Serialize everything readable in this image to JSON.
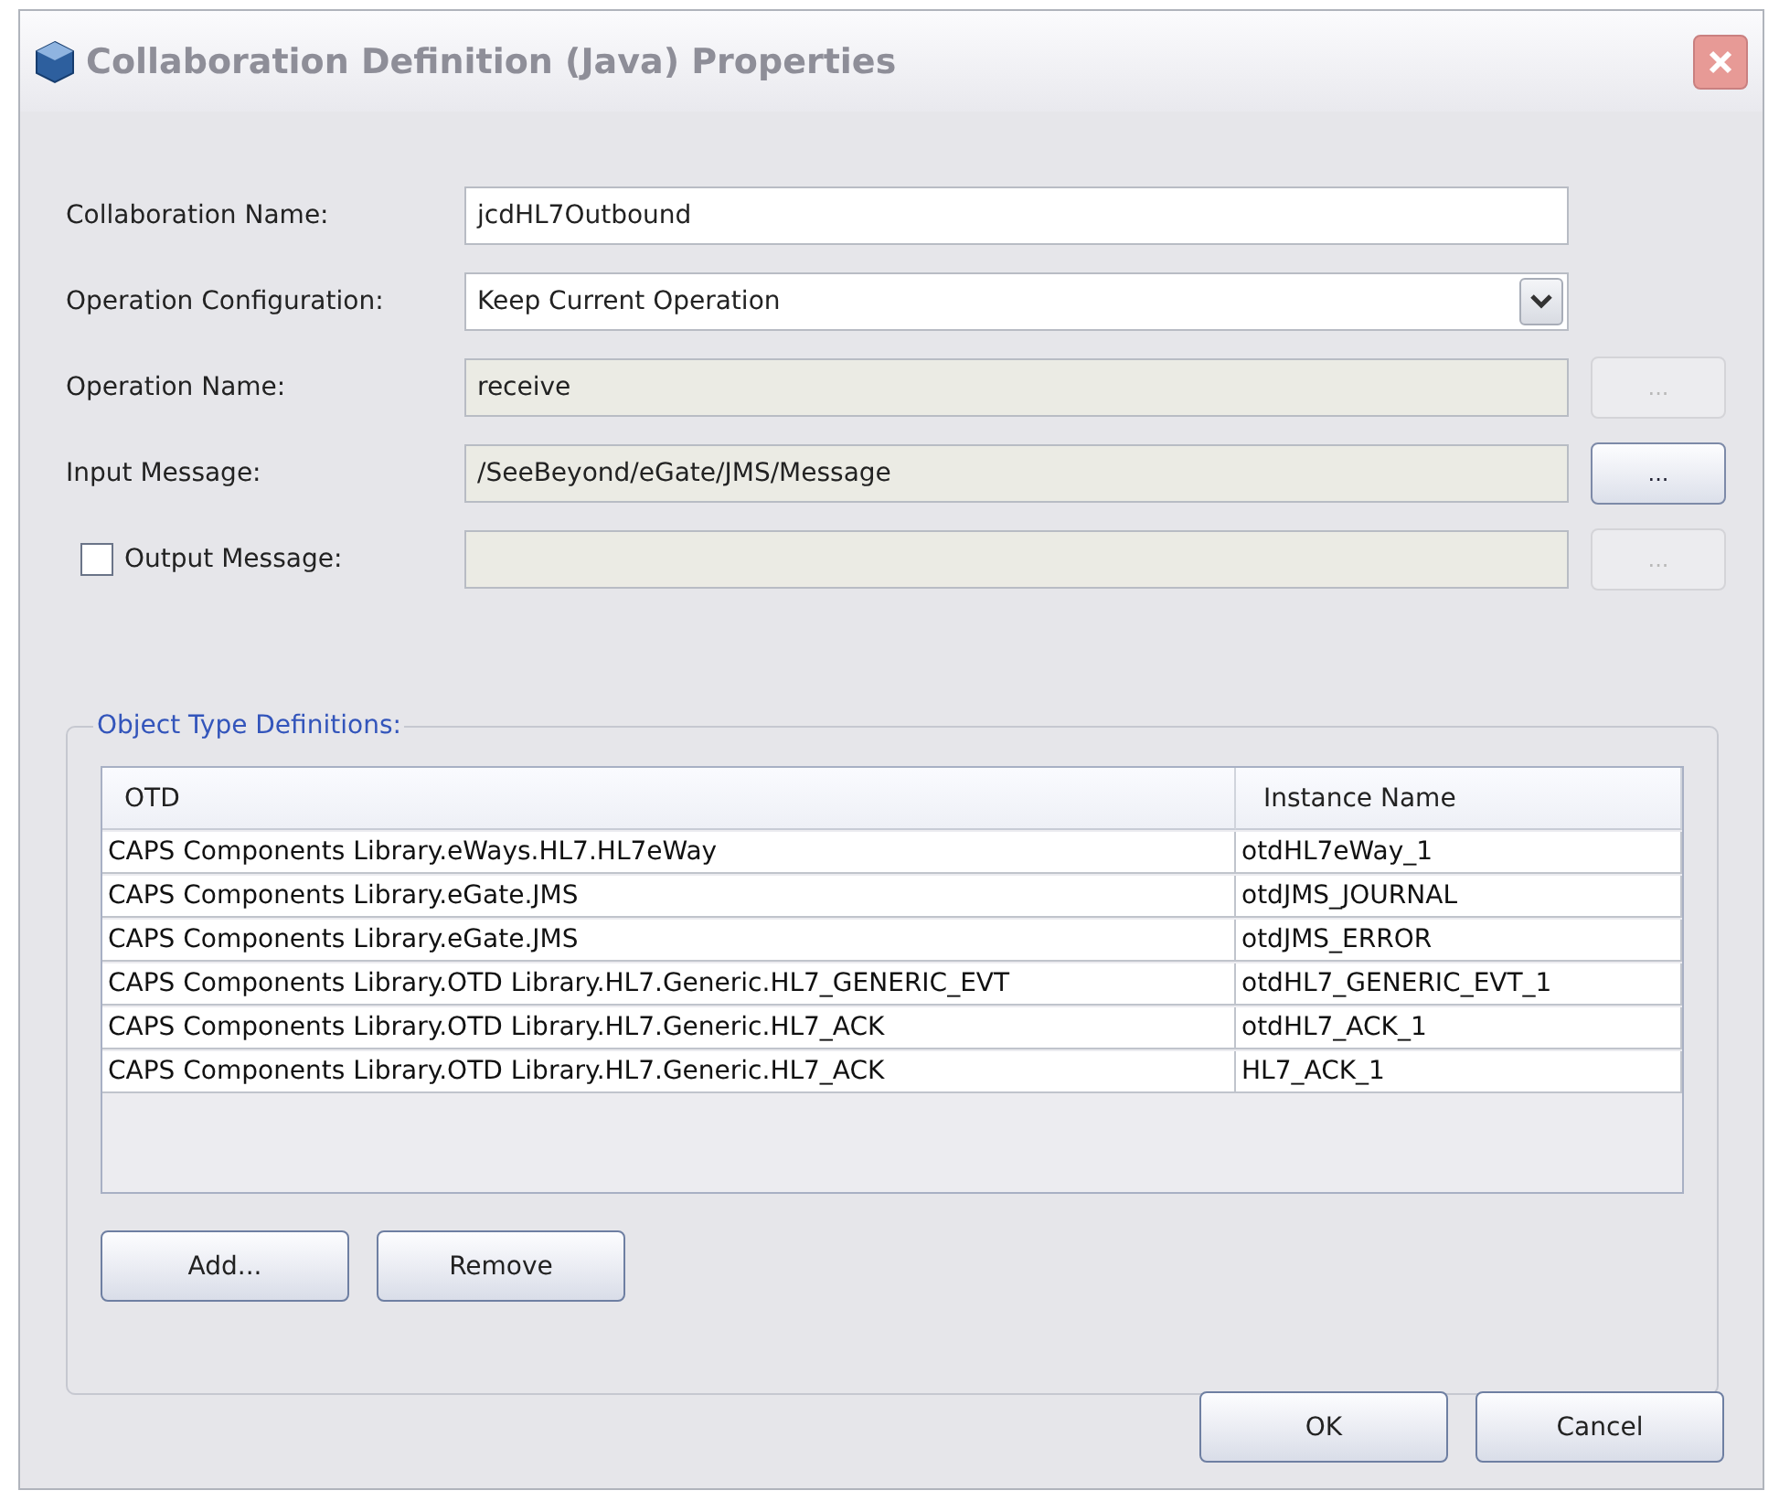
{
  "window": {
    "title": "Collaboration Definition (Java) Properties"
  },
  "fields": [
    {
      "kind": "text",
      "label": "Collaboration Name:",
      "value": "jcdHL7Outbound",
      "disabled": false
    },
    {
      "kind": "combo",
      "label": "Operation Configuration:",
      "value": "Keep Current Operation",
      "disabled": false
    },
    {
      "kind": "text",
      "label": "Operation Name:",
      "value": "receive",
      "disabled": true,
      "browse": {
        "text": "...",
        "disabled": true
      }
    },
    {
      "kind": "text",
      "label": "Input Message:",
      "value": "/SeeBeyond/eGate/JMS/Message",
      "disabled": true,
      "browse": {
        "text": "...",
        "disabled": false
      }
    },
    {
      "kind": "checkfield",
      "label": "Output Message:",
      "checked": false,
      "disabled": true,
      "browse": {
        "text": "...",
        "disabled": true
      }
    }
  ],
  "otd_group": {
    "title": "Object Type Definitions:",
    "table": {
      "columns": [
        "OTD",
        "Instance Name"
      ],
      "rows": [
        [
          "CAPS Components Library.eWays.HL7.HL7eWay",
          "otdHL7eWay_1"
        ],
        [
          "CAPS Components Library.eGate.JMS",
          "otdJMS_JOURNAL"
        ],
        [
          "CAPS Components Library.eGate.JMS",
          "otdJMS_ERROR"
        ],
        [
          "CAPS Components Library.OTD Library.HL7.Generic.HL7_GENERIC_EVT",
          "otdHL7_GENERIC_EVT_1"
        ],
        [
          "CAPS Components Library.OTD Library.HL7.Generic.HL7_ACK",
          "otdHL7_ACK_1"
        ],
        [
          "CAPS Components Library.OTD Library.HL7.Generic.HL7_ACK",
          "HL7_ACK_1"
        ]
      ]
    },
    "buttons": [
      "Add...",
      "Remove"
    ]
  },
  "buttons": [
    "OK",
    "Cancel"
  ]
}
